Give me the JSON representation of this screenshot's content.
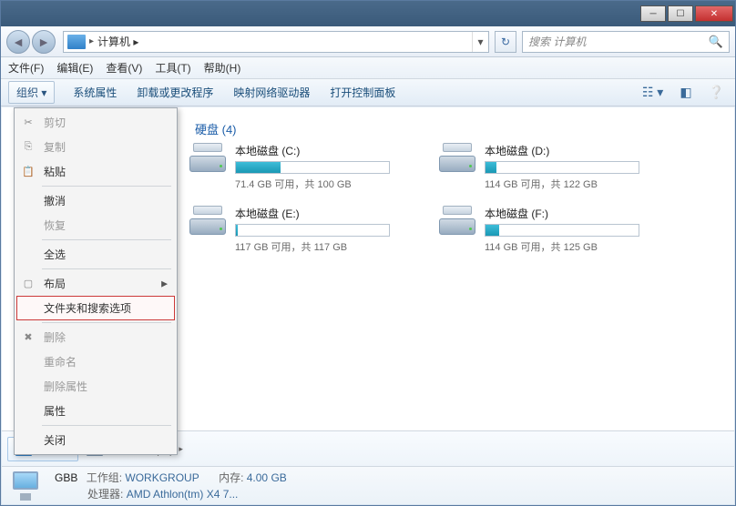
{
  "address": {
    "path": "计算机 ▸",
    "search_placeholder": "搜索 计算机"
  },
  "menubar": [
    "文件(F)",
    "编辑(E)",
    "查看(V)",
    "工具(T)",
    "帮助(H)"
  ],
  "toolbar": {
    "organize": "组织 ▾",
    "items": [
      "系统属性",
      "卸载或更改程序",
      "映射网络驱动器",
      "打开控制面板"
    ]
  },
  "section_header": "硬盘 (4)",
  "drives": [
    {
      "name": "本地磁盘 (C:)",
      "free": "71.4 GB 可用，共 100 GB",
      "pct": 29
    },
    {
      "name": "本地磁盘 (D:)",
      "free": "114 GB 可用，共 122 GB",
      "pct": 7
    },
    {
      "name": "本地磁盘 (E:)",
      "free": "117 GB 可用，共 117 GB",
      "pct": 1
    },
    {
      "name": "本地磁盘 (F:)",
      "free": "114 GB 可用，共 125 GB",
      "pct": 9
    }
  ],
  "dropdown": {
    "cut": "剪切",
    "copy": "复制",
    "paste": "粘贴",
    "undo": "撤消",
    "redo": "恢复",
    "selectall": "全选",
    "layout": "布局",
    "folder_options": "文件夹和搜索选项",
    "delete": "删除",
    "rename": "重命名",
    "remove_props": "删除属性",
    "properties": "属性",
    "close": "关闭"
  },
  "breadcrumb": {
    "computer": "计算机",
    "drive": "本地磁盘 (C:)"
  },
  "statusbar": {
    "name": "GBB",
    "workgroup_label": "工作组:",
    "workgroup": "WORKGROUP",
    "memory_label": "内存:",
    "memory": "4.00 GB",
    "cpu_label": "处理器:",
    "cpu": "AMD Athlon(tm) X4 7..."
  }
}
